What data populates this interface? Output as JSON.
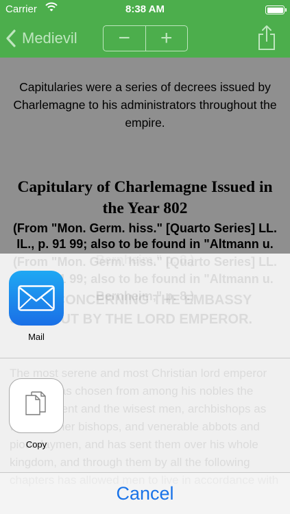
{
  "status_bar": {
    "carrier": "Carrier",
    "time": "8:38 AM"
  },
  "nav": {
    "back_label": "Medievil",
    "decrease_label": "−",
    "increase_label": "+"
  },
  "content": {
    "intro": "Capitularies were a series of decrees issued by Charlemagne to his administrators throughout the empire.",
    "title": "Capitulary of Charlemagne Issued in the Year 802",
    "source": "(From \"Mon. Germ. hiss.\" [Quarto Series] LL. IL., p. 91 99; also to be found in \"Altmann u. Bernheim,\" p. 8.)",
    "heading": "FIRST, CONCERNING THE EMBASSY SENT OUT BY THE LORD EMPEROR.",
    "body": "The most serene and most Christian lord emperor Charles has chosen from among his nobles the most prudent and the wisest men, archbishops as well as other bishops, and venerable abbots and pious laymen, and has sent them over his whole kingdom, and through them by all the following chapters has allowed men to live in accordance with"
  },
  "share_sheet": {
    "items": [
      {
        "label": "Mail",
        "icon": "mail-icon"
      },
      {
        "label": "Copy",
        "icon": "copy-icon"
      }
    ],
    "cancel_label": "Cancel"
  },
  "colors": {
    "nav_green": "#4cae4c",
    "nav_tint": "#bfe6bf",
    "cancel_blue": "#1a73e8",
    "content_gray": "#8f8f8f"
  }
}
